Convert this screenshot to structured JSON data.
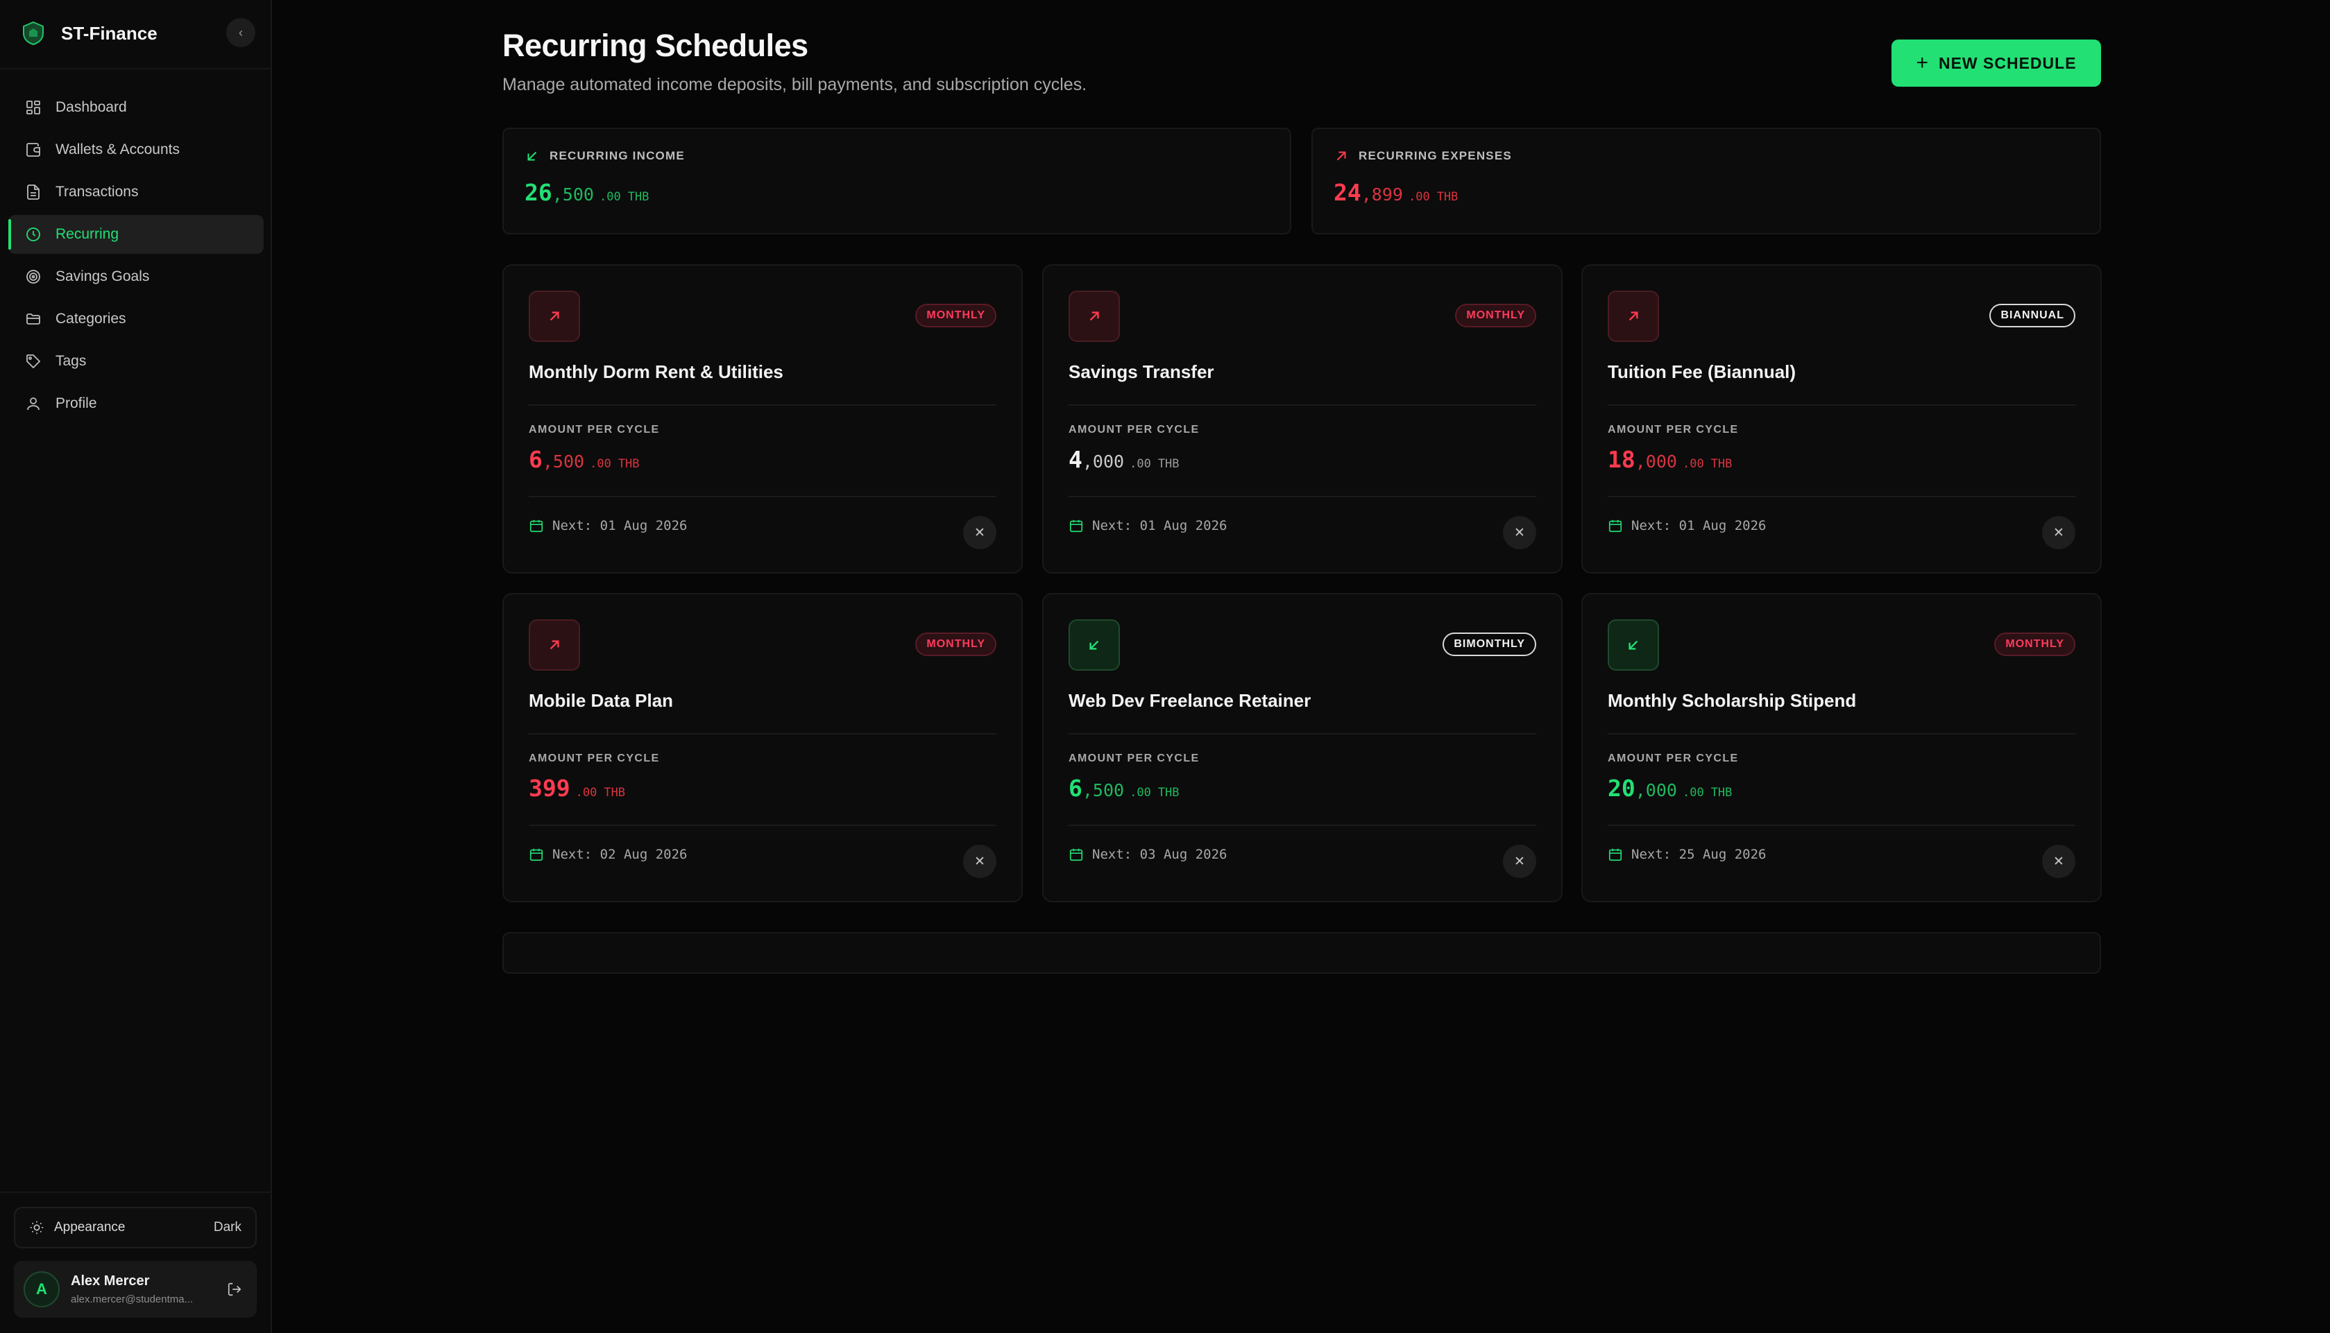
{
  "brand": {
    "name": "ST-Finance",
    "collapse_icon": "‹"
  },
  "nav": [
    {
      "label": "Dashboard",
      "icon": "dashboard-icon",
      "active": false
    },
    {
      "label": "Wallets & Accounts",
      "icon": "wallet-icon",
      "active": false
    },
    {
      "label": "Transactions",
      "icon": "document-icon",
      "active": false
    },
    {
      "label": "Recurring",
      "icon": "clock-icon",
      "active": true
    },
    {
      "label": "Savings Goals",
      "icon": "target-icon",
      "active": false
    },
    {
      "label": "Categories",
      "icon": "folder-icon",
      "active": false
    },
    {
      "label": "Tags",
      "icon": "tag-icon",
      "active": false
    },
    {
      "label": "Profile",
      "icon": "user-icon",
      "active": false
    }
  ],
  "appearance": {
    "label": "Appearance",
    "value": "Dark"
  },
  "user": {
    "initial": "A",
    "name": "Alex Mercer",
    "email": "alex.mercer@studentma..."
  },
  "header": {
    "title": "Recurring Schedules",
    "subtitle": "Manage automated income deposits, bill payments, and subscription cycles.",
    "new_button": "NEW SCHEDULE"
  },
  "summary": {
    "income": {
      "label": "RECURRING INCOME",
      "int": "26",
      "thousands": ",500",
      "dec": ".00",
      "currency": "THB"
    },
    "expenses": {
      "label": "RECURRING EXPENSES",
      "int": "24",
      "thousands": ",899",
      "dec": ".00",
      "currency": "THB"
    }
  },
  "amount_label": "AMOUNT PER CYCLE",
  "cards": [
    {
      "name": "Monthly Dorm Rent & Utilities",
      "badge": "MONTHLY",
      "badge_style": "red",
      "type": "expense",
      "amount_color": "red",
      "int": "6",
      "thousands": ",500",
      "dec": ".00",
      "currency": "THB",
      "next": "Next: 01 Aug 2026"
    },
    {
      "name": "Savings Transfer",
      "badge": "MONTHLY",
      "badge_style": "red",
      "type": "expense",
      "amount_color": "white",
      "int": "4",
      "thousands": ",000",
      "dec": ".00",
      "currency": "THB",
      "next": "Next: 01 Aug 2026"
    },
    {
      "name": "Tuition Fee (Biannual)",
      "badge": "BIANNUAL",
      "badge_style": "white",
      "type": "expense",
      "amount_color": "red",
      "int": "18",
      "thousands": ",000",
      "dec": ".00",
      "currency": "THB",
      "next": "Next: 01 Aug 2026"
    },
    {
      "name": "Mobile Data Plan",
      "badge": "MONTHLY",
      "badge_style": "red",
      "type": "expense",
      "amount_color": "red",
      "int": "399",
      "thousands": "",
      "dec": ".00",
      "currency": "THB",
      "next": "Next: 02 Aug 2026"
    },
    {
      "name": "Web Dev Freelance Retainer",
      "badge": "BIMONTHLY",
      "badge_style": "white",
      "type": "income",
      "amount_color": "green",
      "int": "6",
      "thousands": ",500",
      "dec": ".00",
      "currency": "THB",
      "next": "Next: 03 Aug 2026"
    },
    {
      "name": "Monthly Scholarship Stipend",
      "badge": "MONTHLY",
      "badge_style": "red",
      "type": "income",
      "amount_color": "green",
      "int": "20",
      "thousands": ",000",
      "dec": ".00",
      "currency": "THB",
      "next": "Next: 25 Aug 2026"
    }
  ],
  "colors": {
    "accent": "#22e074",
    "expense": "#ff3b4f",
    "background": "#060606"
  }
}
